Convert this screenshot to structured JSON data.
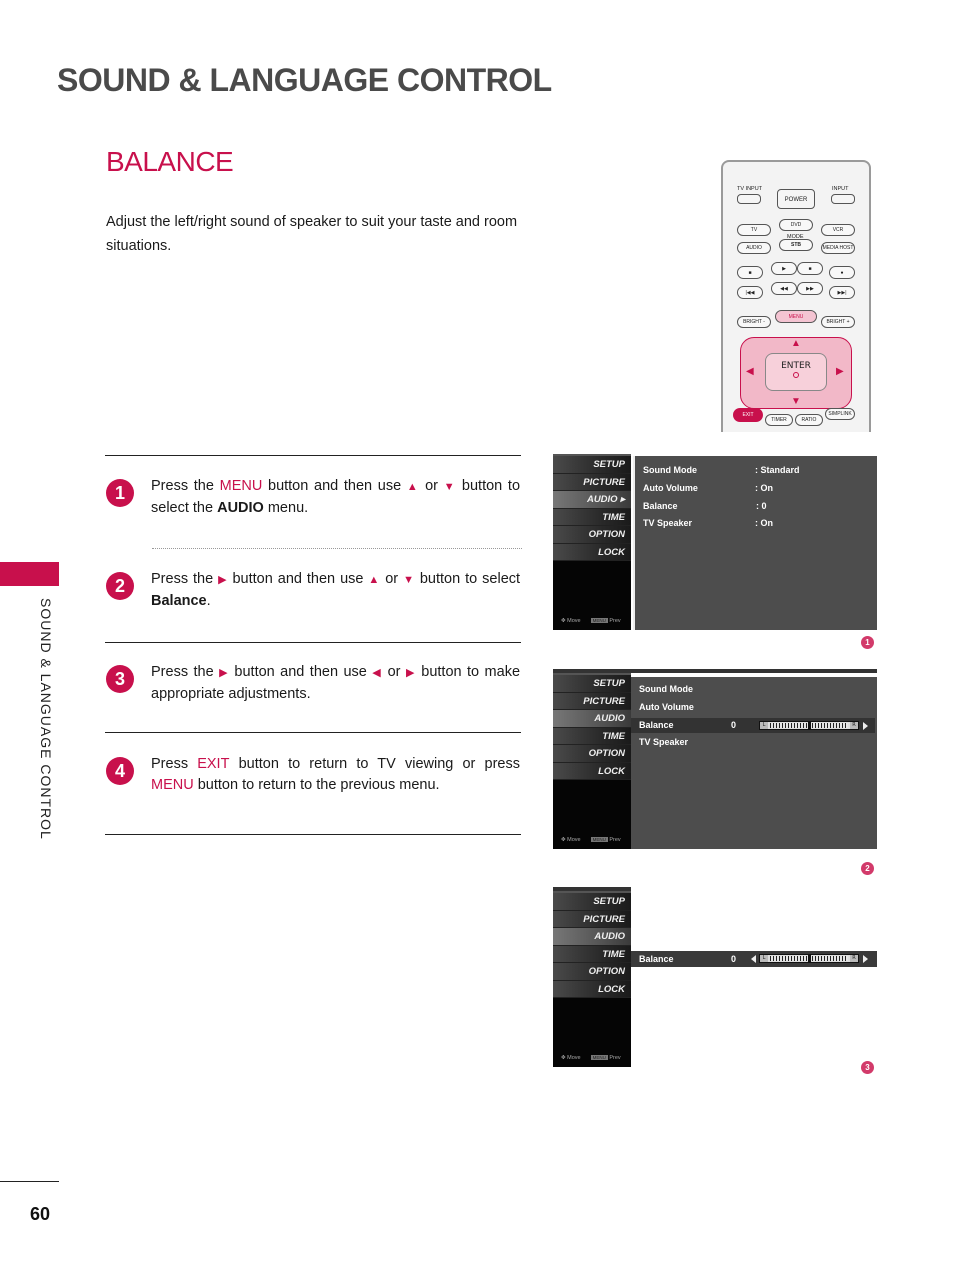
{
  "page": {
    "main_title": "SOUND & LANGUAGE CONTROL",
    "section_title": "BALANCE",
    "intro": "Adjust the left/right sound of speaker to suit your taste and room situations.",
    "side_label": "SOUND & LANGUAGE CONTROL",
    "page_number": "60",
    "accent_color": "#c8104c"
  },
  "steps": [
    {
      "number": "1",
      "parts": [
        "Press the ",
        "MENU",
        " button and then use ",
        "▲",
        " or ",
        "▼",
        " button to select the ",
        "AUDIO",
        " menu."
      ]
    },
    {
      "number": "2",
      "parts": [
        "Press the ",
        "▶",
        " button and then use ",
        "▲",
        " or ",
        "▼",
        " button to select ",
        "Balance",
        "."
      ]
    },
    {
      "number": "3",
      "parts": [
        "Press the ",
        "▶",
        " button and then use ",
        "◀",
        " or ",
        "▶",
        " button to make appropriate adjustments."
      ]
    },
    {
      "number": "4",
      "parts": [
        "Press ",
        "EXIT",
        " button to return to TV viewing or press ",
        "MENU",
        " button to return to the previous menu."
      ]
    }
  ],
  "remote": {
    "tv_input": "TV INPUT",
    "power": "POWER",
    "input": "INPUT",
    "tv": "TV",
    "dvd": "DVD",
    "vcr": "VCR",
    "mode": "MODE",
    "audio": "AUDIO",
    "stb": "STB",
    "media_host": "MEDIA HOST",
    "bright_minus": "BRIGHT -",
    "menu": "MENU",
    "bright_plus": "BRIGHT +",
    "enter": "ENTER",
    "exit": "EXIT",
    "timer": "TIMER",
    "ratio": "RATIO",
    "simplink": "SIMPLINK",
    "play": "▶",
    "stop": "■",
    "record": "●",
    "pause": "■",
    "prev": "|◀◀",
    "rew": "◀◀",
    "ff": "▶▶",
    "next": "▶▶|",
    "up": "▲",
    "down": "▼",
    "left": "◀",
    "right": "▶"
  },
  "osd_menu": {
    "items": [
      "SETUP",
      "PICTURE",
      "AUDIO",
      "TIME",
      "OPTION",
      "LOCK"
    ],
    "footer_move": "Move",
    "footer_menu_chip": "MENU",
    "footer_prev": "Prev"
  },
  "screens": [
    {
      "badge": "1",
      "rows": [
        {
          "label": "Sound Mode",
          "value": ": Standard"
        },
        {
          "label": "Auto Volume",
          "value": ": On"
        },
        {
          "label": "Balance",
          "value": ": 0"
        },
        {
          "label": "TV Speaker",
          "value": ": On"
        }
      ]
    },
    {
      "badge": "2",
      "rows": [
        {
          "label": "Sound Mode"
        },
        {
          "label": "Auto Volume"
        },
        {
          "label": "Balance",
          "value": "0",
          "slider_left": "L",
          "slider_right": "R",
          "balance_percent": 50
        },
        {
          "label": "TV Speaker"
        }
      ]
    },
    {
      "badge": "3",
      "rows": [
        {
          "label": "Balance",
          "value": "0",
          "slider_left": "L",
          "slider_right": "R",
          "balance_percent": 50
        }
      ]
    }
  ]
}
